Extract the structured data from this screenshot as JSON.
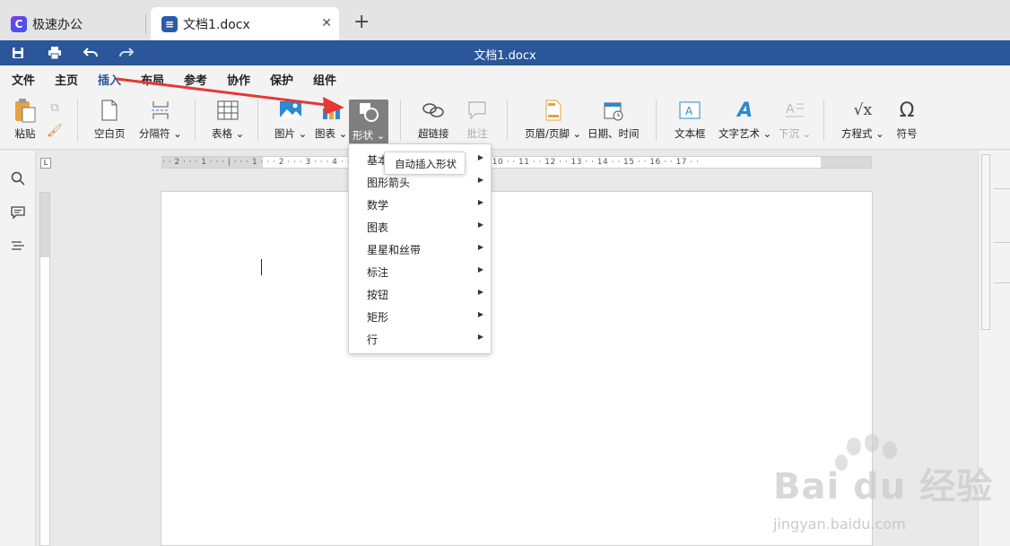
{
  "tabs": {
    "app_label": "极速办公",
    "doc_label": "文档1.docx",
    "close_glyph": "✕",
    "new_tab_glyph": "+"
  },
  "titlebar": {
    "title": "文档1.docx",
    "color": "#2b579a"
  },
  "menu": {
    "items": [
      "文件",
      "主页",
      "插入",
      "布局",
      "参考",
      "协作",
      "保护",
      "组件"
    ],
    "active": "插入"
  },
  "ribbon": {
    "paste": "粘贴",
    "blank_page": "空白页",
    "separator": "分隔符",
    "table": "表格",
    "picture": "图片",
    "chart": "图表",
    "shape": "形状",
    "hyperlink": "超链接",
    "comment": "批注",
    "header_footer": "页眉/页脚",
    "date_time": "日期、时间",
    "textbox": "文本框",
    "wordart": "文字艺术",
    "dropcap": "下沉",
    "equation": "方程式",
    "symbol": "符号",
    "dropdown_glyph": "⌄"
  },
  "ruler": {
    "h_numbers": "· · 2 · · · 1 · · · | · · · 1 · · · 2 · · · 3 · · · 4 · · · 5 · · · 6 · · · 7 · · · 8 · · · 9 · · · 10 · · 11 · · 12 · · 13 · · 14 · · 15 · · 16 · · 17 · ·",
    "corner_mark": "L"
  },
  "shape_menu": {
    "items": [
      "基本",
      "图形箭头",
      "数学",
      "图表",
      "星星和丝带",
      "标注",
      "按钮",
      "矩形",
      "行"
    ],
    "tooltip": "自动插入形状",
    "arrow_glyph": "▶"
  },
  "watermark": {
    "text": "Bai du 经验",
    "url": "jingyan.baidu.com"
  },
  "annotation": {
    "arrow_color": "#e53935"
  }
}
